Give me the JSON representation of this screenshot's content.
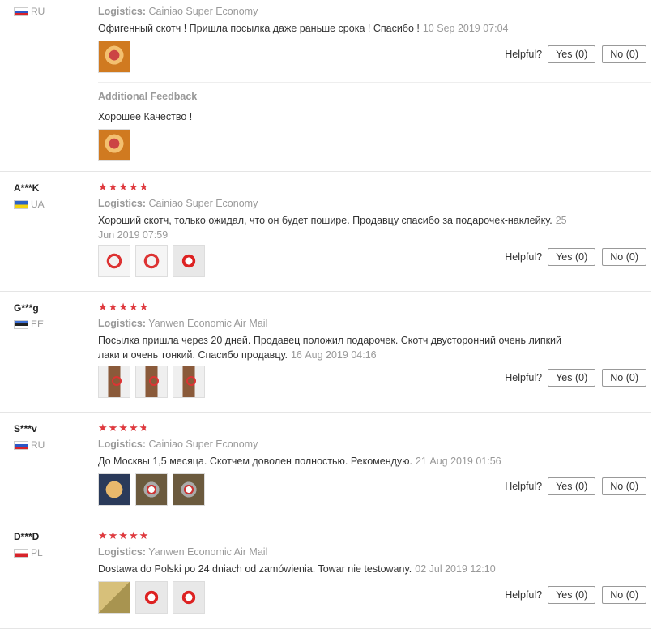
{
  "labels": {
    "helpful": "Helpful?",
    "additional_feedback": "Additional Feedback"
  },
  "reviews": [
    {
      "user": "",
      "country": "RU",
      "rating": null,
      "logistics_label": "Logistics:",
      "logistics": "Cainiao Super Economy",
      "text": "Офигенный скотч ! Пришла посылка даже раньше срока ! Спасибо !",
      "date": "10 Sep 2019 07:04",
      "yes": "Yes (0)",
      "no": "No (0)",
      "additional": {
        "text": "Хорошее Качество !"
      }
    },
    {
      "user": "A***K",
      "country": "UA",
      "rating": 4.5,
      "logistics_label": "Logistics:",
      "logistics": "Cainiao Super Economy",
      "text": "Хороший скотч, только ожидал, что он будет пошире. Продавцу спасибо за подарочек-наклейку.",
      "date": "25 Jun 2019 07:59",
      "yes": "Yes (0)",
      "no": "No (0)"
    },
    {
      "user": "G***g",
      "country": "EE",
      "rating": 5,
      "logistics_label": "Logistics:",
      "logistics": "Yanwen Economic Air Mail",
      "text": "Посылка пришла через 20 дней. Продавец положил подарочек. Скотч двусторонний очень липкий лаки и очень тонкий. Спасибо продавцу.",
      "date": "16 Aug 2019 04:16",
      "yes": "Yes (0)",
      "no": "No (0)"
    },
    {
      "user": "S***v",
      "country": "RU",
      "rating": 4.5,
      "logistics_label": "Logistics:",
      "logistics": "Cainiao Super Economy",
      "text": "До Москвы 1,5 месяца. Скотчем доволен полностью. Рекомендую.",
      "date": "21 Aug 2019 01:56",
      "yes": "Yes (0)",
      "no": "No (0)"
    },
    {
      "user": "D***D",
      "country": "PL",
      "rating": 5,
      "logistics_label": "Logistics:",
      "logistics": "Yanwen Economic Air Mail",
      "text": "Dostawa do Polski po 24 dniach od zamówienia. Towar nie testowany.",
      "date": "02 Jul 2019 12:10",
      "yes": "Yes (0)",
      "no": "No (0)"
    }
  ],
  "colors": {
    "star": "#e0393e",
    "muted": "#999999"
  }
}
